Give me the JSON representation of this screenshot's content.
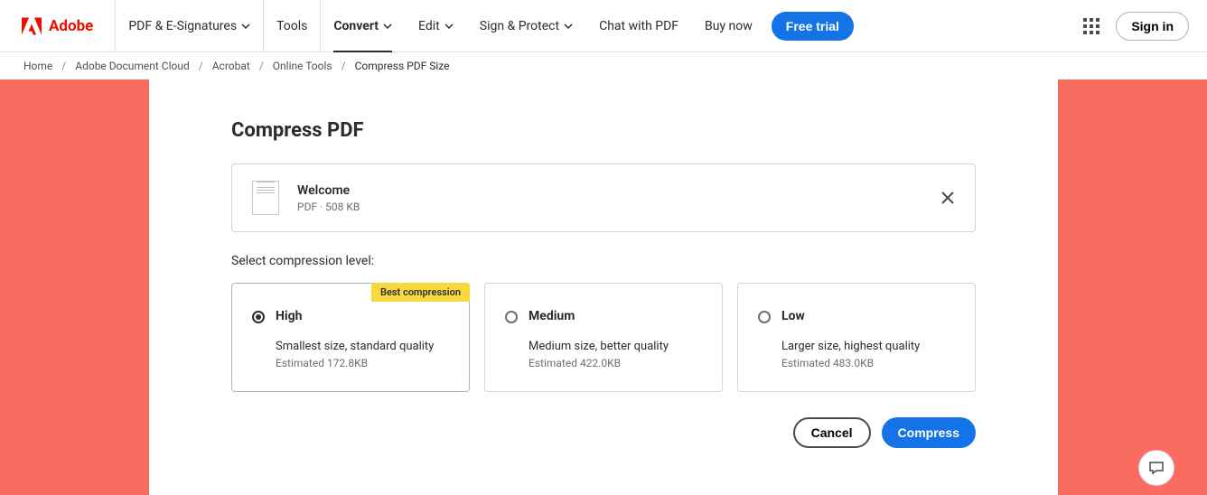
{
  "brand": {
    "name": "Adobe"
  },
  "nav": {
    "items": [
      {
        "label": "PDF & E-Signatures",
        "hasChevron": true
      },
      {
        "label": "Tools",
        "hasChevron": false
      },
      {
        "label": "Convert",
        "hasChevron": true,
        "active": true
      },
      {
        "label": "Edit",
        "hasChevron": true
      },
      {
        "label": "Sign & Protect",
        "hasChevron": true
      },
      {
        "label": "Chat with PDF",
        "hasChevron": false
      },
      {
        "label": "Buy now",
        "hasChevron": false
      }
    ],
    "freeTrial": "Free trial",
    "signIn": "Sign in"
  },
  "breadcrumb": {
    "items": [
      "Home",
      "Adobe Document Cloud",
      "Acrobat",
      "Online Tools"
    ],
    "current": "Compress PDF Size"
  },
  "page": {
    "title": "Compress PDF",
    "file": {
      "name": "Welcome",
      "meta": "PDF · 508 KB"
    },
    "sectionLabel": "Select compression level:",
    "options": [
      {
        "title": "High",
        "desc": "Smallest size, standard quality",
        "est": "Estimated 172.8KB",
        "badge": "Best compression",
        "selected": true
      },
      {
        "title": "Medium",
        "desc": "Medium size, better quality",
        "est": "Estimated 422.0KB",
        "selected": false
      },
      {
        "title": "Low",
        "desc": "Larger size, highest quality",
        "est": "Estimated 483.0KB",
        "selected": false
      }
    ],
    "actions": {
      "cancel": "Cancel",
      "compress": "Compress"
    }
  }
}
